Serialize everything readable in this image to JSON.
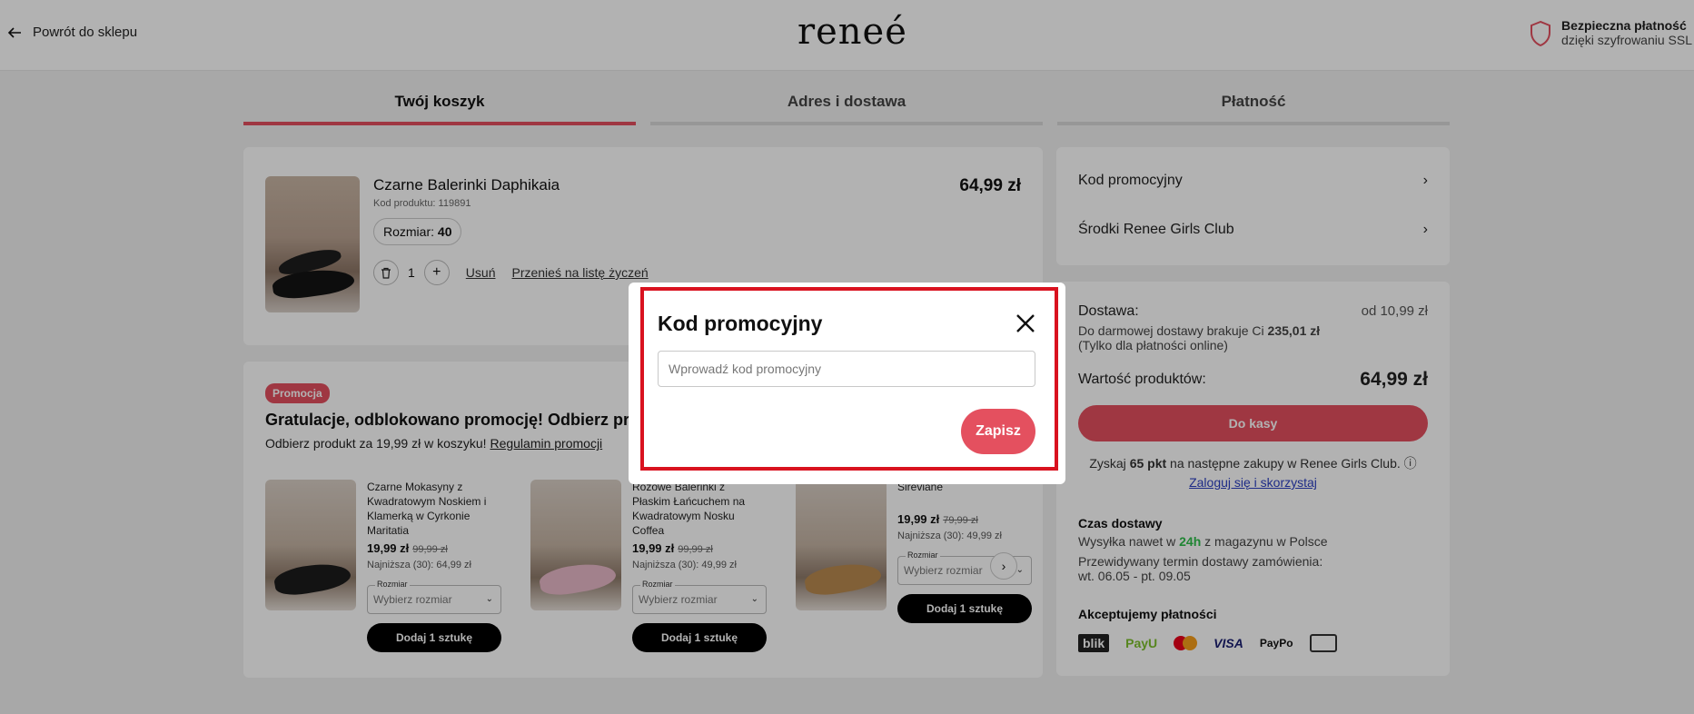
{
  "header": {
    "back_label": "Powrót do sklepu",
    "logo": "reneé",
    "secure_title": "Bezpieczna płatność",
    "secure_sub": "dzięki szyfrowaniu SSL"
  },
  "steps": [
    "Twój koszyk",
    "Adres i dostawa",
    "Płatność"
  ],
  "cart_item": {
    "name": "Czarne Balerinki Daphikaia",
    "code": "Kod produktu: 119891",
    "size_label": "Rozmiar:",
    "size_value": "40",
    "qty": "1",
    "remove": "Usuń",
    "wishlist": "Przenieś na listę życzeń",
    "price": "64,99 zł"
  },
  "promo": {
    "badge": "Promocja",
    "title": "Gratulacje, odblokowano promocję! Odbierz prod",
    "sub_text": "Odbierz produkt za 19,99 zł w koszyku!",
    "sub_link": "Regulamin promocji",
    "products": [
      {
        "name": "Czarne Mokasyny z Kwadratowym Noskiem i Klamerką w Cyrkonie Maritatia",
        "price": "19,99 zł",
        "old_price": "99,99 zł",
        "lowest": "Najniższa (30): 64,99 zł",
        "size_label": "Rozmiar",
        "size_placeholder": "Wybierz rozmiar",
        "add": "Dodaj 1 sztukę"
      },
      {
        "name": "Różowe Balerinki z Płaskim Łańcuchem na Kwadratowym Nosku Coffea",
        "price": "19,99 zł",
        "old_price": "99,99 zł",
        "lowest": "Najniższa (30): 49,99 zł",
        "size_label": "Rozmiar",
        "size_placeholder": "Wybierz rozmiar",
        "add": "Dodaj 1 sztukę"
      },
      {
        "name": "Ciemnobeżowe Mokasyn Sireviane",
        "price": "19,99 zł",
        "old_price": "79,99 zł",
        "lowest": "Najniższa (30): 49,99 zł",
        "size_label": "Rozmiar",
        "size_placeholder": "Wybierz rozmiar",
        "add": "Dodaj 1 sztukę"
      }
    ]
  },
  "summary": {
    "promo_code": "Kod promocyjny",
    "club_funds": "Środki Renee Girls Club",
    "delivery_label": "Dostawa:",
    "delivery_value": "od 10,99 zł",
    "free_delivery_text": "Do darmowej dostawy brakuje Ci",
    "free_delivery_amount": "235,01 zł",
    "free_delivery_note": "(Tylko dla płatności online)",
    "products_value_label": "Wartość produktów:",
    "products_value": "64,99 zł",
    "checkout": "Do kasy",
    "points_pre": "Zyskaj",
    "points_value": "65 pkt",
    "points_post": "na następne zakupy w Renee Girls Club.",
    "login_link": "Zaloguj się i skorzystaj",
    "delivery_time_title": "Czas dostawy",
    "delivery_time_pre": "Wysyłka nawet w",
    "delivery_time_hl": "24h",
    "delivery_time_post": "z magazynu w Polsce",
    "estimate_label": "Przewidywany termin dostawy zamówienia:",
    "estimate_value": "wt. 06.05 - pt. 09.05",
    "payments_title": "Akceptujemy płatności",
    "payment_logos": [
      "blik",
      "PayU",
      "mastercard",
      "VISA",
      "PayPo",
      "transfer"
    ]
  },
  "modal": {
    "title": "Kod promocyjny",
    "input_placeholder": "Wprowadź kod promocyjny",
    "input_value": "",
    "save": "Zapisz"
  },
  "colors": {
    "accent": "#e4505f",
    "highlight_frame": "#d9121f",
    "green": "#2fbf4a"
  }
}
